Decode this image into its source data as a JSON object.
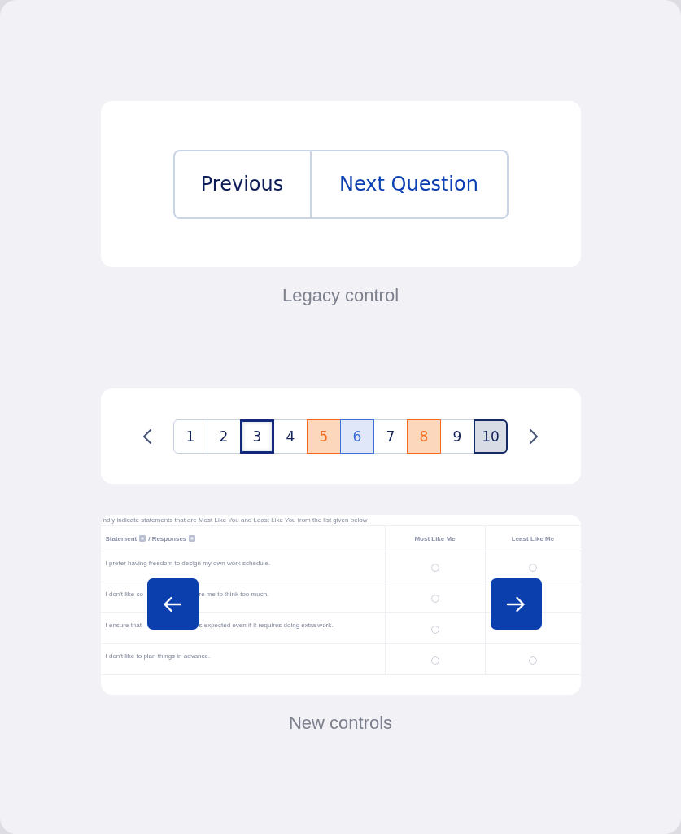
{
  "legacy_control": {
    "buttons": [
      {
        "label": "Previous",
        "kind": "secondary"
      },
      {
        "label": "Next Question",
        "kind": "primary"
      }
    ]
  },
  "legacy_caption": "Legacy control",
  "pagination": {
    "pages": [
      {
        "label": "1",
        "kind": "plain",
        "selected": false
      },
      {
        "label": "2",
        "kind": "plain",
        "selected": false
      },
      {
        "label": "3",
        "kind": "plain",
        "selected": true
      },
      {
        "label": "4",
        "kind": "plain",
        "selected": false
      },
      {
        "label": "5",
        "kind": "flagged",
        "selected": false
      },
      {
        "label": "6",
        "kind": "answered",
        "selected": false
      },
      {
        "label": "7",
        "kind": "plain",
        "selected": false
      },
      {
        "label": "8",
        "kind": "flagged",
        "selected": false
      },
      {
        "label": "9",
        "kind": "plain",
        "selected": false
      },
      {
        "label": "10",
        "kind": "marked",
        "selected": false
      }
    ]
  },
  "question_preview": {
    "instruction": "ndly indicate statements that are Most Like You and Least Like You from the list given below",
    "header": {
      "statement": "Statement",
      "responses": "/ Responses",
      "most": "Most Like Me",
      "least": "Least Like Me"
    },
    "rows": [
      {
        "parts": [
          "I prefer having freedom to design my own work schedule."
        ],
        "most_like_me": {
          "checked": false
        },
        "least_like_me": {
          "checked": false
        }
      },
      {
        "parts": [
          "I don't like co",
          "re me to think too much."
        ],
        "most_like_me": {
          "checked": false
        }
      },
      {
        "parts": [
          "I ensure that",
          "s expected even if it requires doing extra work."
        ],
        "most_like_me": {
          "checked": false
        }
      },
      {
        "parts": [
          "I don't like to plan things in advance."
        ],
        "most_like_me": {
          "checked": false
        },
        "least_like_me": {
          "checked": false
        }
      }
    ]
  },
  "new_controls_caption": "New controls"
}
